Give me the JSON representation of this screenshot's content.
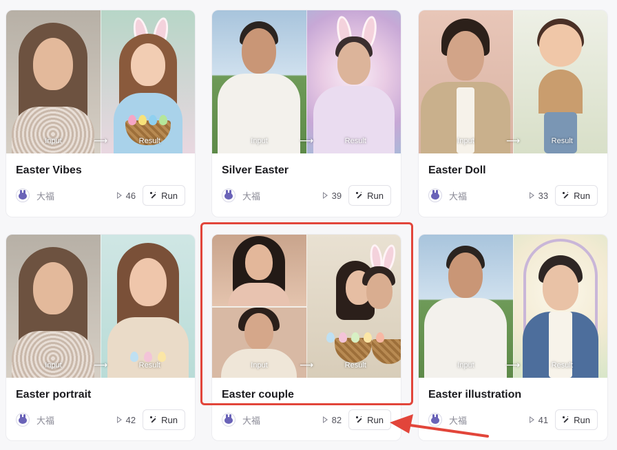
{
  "cards": [
    {
      "title": "Easter Vibes",
      "author": "大福",
      "runs": "46",
      "run_label": "Run",
      "input_label": "Input",
      "result_label": "Result"
    },
    {
      "title": "Silver Easter",
      "author": "大福",
      "runs": "39",
      "run_label": "Run",
      "input_label": "Input",
      "result_label": "Result"
    },
    {
      "title": "Easter Doll",
      "author": "大福",
      "runs": "33",
      "run_label": "Run",
      "input_label": "Input",
      "result_label": "Result"
    },
    {
      "title": "Easter portrait",
      "author": "大福",
      "runs": "42",
      "run_label": "Run",
      "input_label": "Input",
      "result_label": "Result"
    },
    {
      "title": "Easter couple",
      "author": "大福",
      "runs": "82",
      "run_label": "Run",
      "input_label": "Input",
      "result_label": "Result"
    },
    {
      "title": "Easter illustration",
      "author": "大福",
      "runs": "41",
      "run_label": "Run",
      "input_label": "Input",
      "result_label": "Result"
    }
  ],
  "annotation": {
    "highlight_color": "#e2453a",
    "highlighted_card": "Easter couple",
    "arrow_target": "run-button"
  },
  "icons": {
    "author_avatar": "bunny-avatar-icon",
    "run_count": "play-icon",
    "run_button": "magic-wand-icon",
    "between_images": "arrow-right-icon"
  },
  "colors": {
    "card_bg": "#ffffff",
    "page_bg": "#f7f7f9",
    "title_text": "#1b1b1f",
    "muted_text": "#8a8a96"
  }
}
